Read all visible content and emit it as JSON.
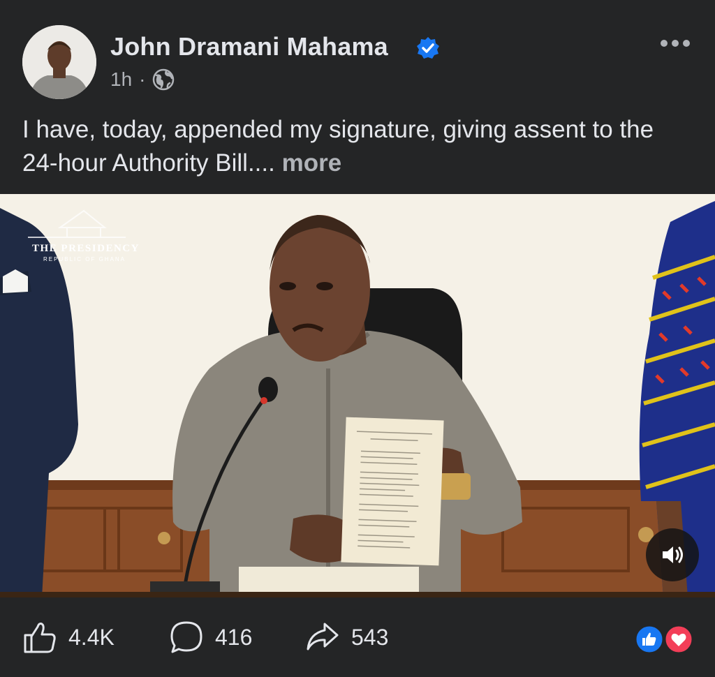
{
  "post": {
    "author": "John Dramani Mahama",
    "time": "1h",
    "separator": "·",
    "text": "I have, today, appended my signature, giving assent to the 24-hour Authority Bill.... ",
    "see_more": "more"
  },
  "media": {
    "watermark_title": "THE PRESIDENCY",
    "watermark_sub": "REPUBLIC OF GHANA"
  },
  "actions": {
    "likes": "4.4K",
    "comments": "416",
    "shares": "543"
  },
  "icons": {
    "verified": "verified-badge-icon",
    "audience": "globe-icon",
    "menu": "more-options-icon",
    "like": "thumbs-up-icon",
    "comment": "comment-bubble-icon",
    "share": "share-arrow-icon",
    "sound": "speaker-icon",
    "reactions": [
      "like-reaction-icon",
      "love-reaction-icon"
    ]
  },
  "colors": {
    "background": "#242526",
    "verified": "#1877f2",
    "like_reaction": "#1877f2",
    "love_reaction": "#f33e58"
  }
}
